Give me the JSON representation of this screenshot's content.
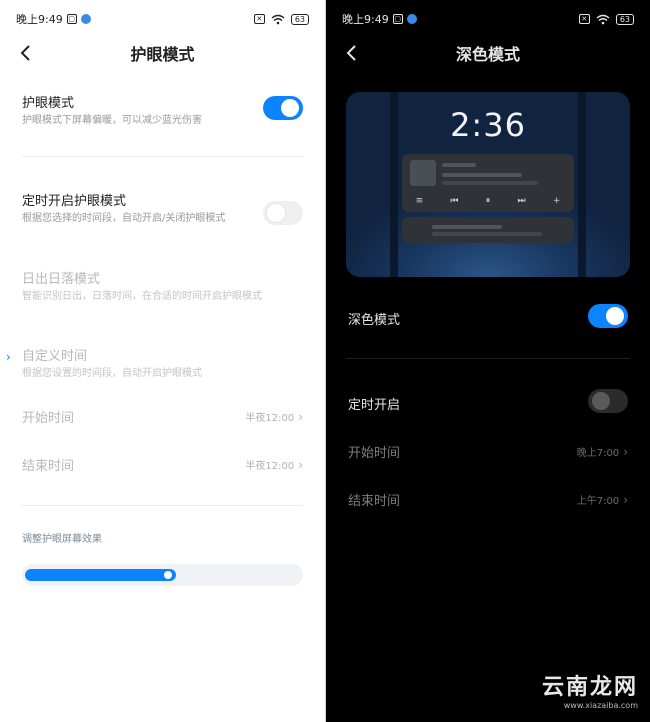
{
  "status": {
    "time": "晚上9:49",
    "battery": "63"
  },
  "light": {
    "title": "护眼模式",
    "eye_mode": {
      "title": "护眼模式",
      "subtitle": "护眼模式下屏幕偏暖，可以减少蓝光伤害",
      "on": true
    },
    "scheduled": {
      "title": "定时开启护眼模式",
      "subtitle": "根据您选择的时间段，自动开启/关闭护眼模式",
      "on": false
    },
    "sunrise": {
      "title": "日出日落模式",
      "subtitle": "智能识别日出，日落时间，在合适的时间开启护眼模式"
    },
    "custom": {
      "title": "自定义时间",
      "subtitle": "根据您设置的时间段，自动开启护眼模式"
    },
    "start_time": {
      "label": "开始时间",
      "value": "半夜12:00"
    },
    "end_time": {
      "label": "结束时间",
      "value": "半夜12:00"
    },
    "adjust_label": "调整护眼屏幕效果",
    "slider_value": 0.55
  },
  "dark": {
    "title": "深色模式",
    "preview_clock": "2:36",
    "dark_mode": {
      "title": "深色模式",
      "on": true
    },
    "scheduled": {
      "title": "定时开启",
      "on": false
    },
    "start_time": {
      "label": "开始时间",
      "value": "晚上7:00"
    },
    "end_time": {
      "label": "结束时间",
      "value": "上午7:00"
    }
  },
  "watermark": {
    "main": "云南龙网",
    "sub": "www.xiazaiba.com"
  },
  "colors": {
    "accent": "#0d84ff"
  },
  "icons": {
    "back": "chevron-left-icon",
    "chevron": "chevron-right-icon",
    "wifi": "wifi-icon"
  }
}
